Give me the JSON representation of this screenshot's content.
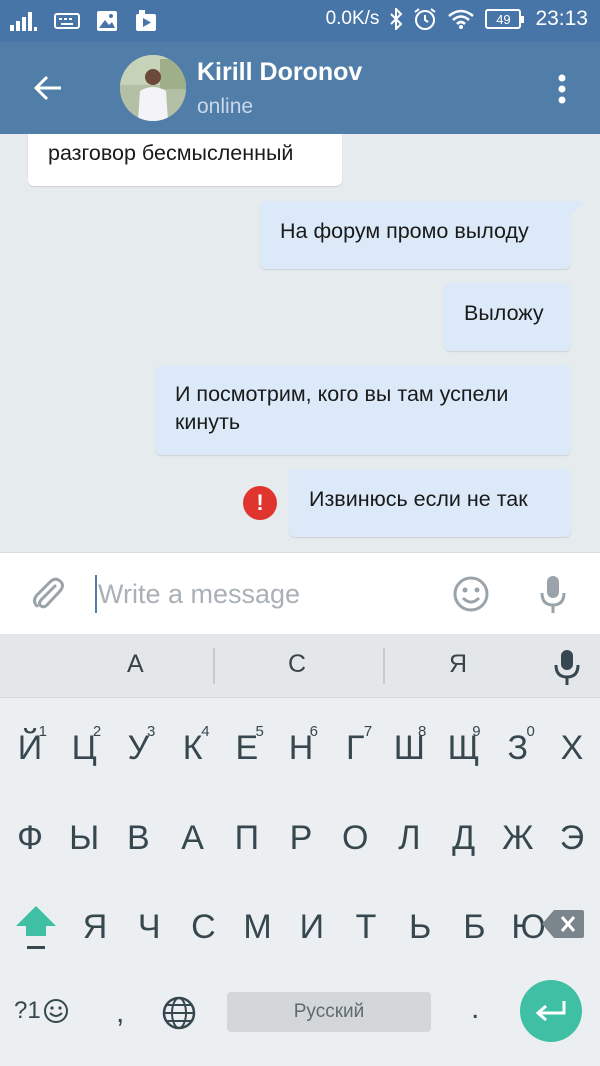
{
  "status_bar": {
    "net_speed": "0.0K/s",
    "battery": "49",
    "time": "23:13"
  },
  "header": {
    "name": "Kirill Doronov",
    "status": "online"
  },
  "messages": [
    {
      "direction": "in",
      "text": "разговор бесмысленный"
    },
    {
      "direction": "out",
      "text": "На форум промо вылоду"
    },
    {
      "direction": "out",
      "text": "Выложу"
    },
    {
      "direction": "out",
      "text": "И посмотрим, кого вы там успели кинуть"
    },
    {
      "direction": "out",
      "text": "Извинюсь если не так",
      "error": true
    }
  ],
  "composer": {
    "placeholder": "Write a message"
  },
  "keyboard": {
    "suggestions": [
      "А",
      "С",
      "Я"
    ],
    "row1": [
      {
        "key": "Й",
        "num": "1"
      },
      {
        "key": "Ц",
        "num": "2"
      },
      {
        "key": "У",
        "num": "3"
      },
      {
        "key": "К",
        "num": "4"
      },
      {
        "key": "Е",
        "num": "5"
      },
      {
        "key": "Н",
        "num": "6"
      },
      {
        "key": "Г",
        "num": "7"
      },
      {
        "key": "Ш",
        "num": "8"
      },
      {
        "key": "Щ",
        "num": "9"
      },
      {
        "key": "З",
        "num": "0"
      },
      {
        "key": "Х",
        "num": ""
      }
    ],
    "row2": [
      "Ф",
      "Ы",
      "В",
      "А",
      "П",
      "Р",
      "О",
      "Л",
      "Д",
      "Ж",
      "Э"
    ],
    "row3": [
      "Я",
      "Ч",
      "С",
      "М",
      "И",
      "Т",
      "Ь",
      "Б",
      "Ю"
    ],
    "symbols_label": "?1",
    "comma": ",",
    "space_label": "Русский",
    "period": "."
  },
  "colors": {
    "header": "#517da9",
    "status_bar": "#4775a8",
    "outgoing_bubble": "#dbe9f8",
    "incoming_bubble": "#ffffff",
    "error": "#e0342f",
    "enter_key": "#3fbfa4"
  }
}
